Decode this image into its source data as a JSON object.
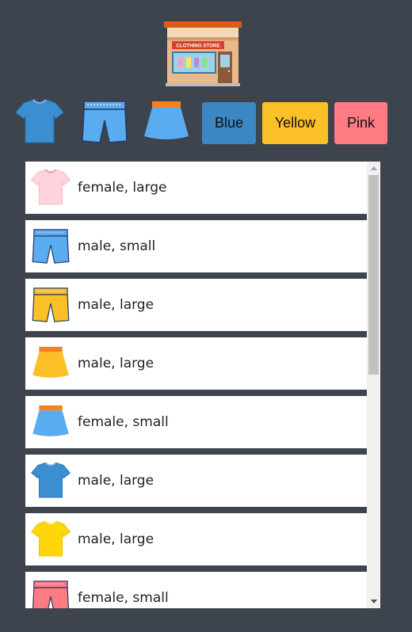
{
  "store": {
    "sign_text": "CLOTHING STORE"
  },
  "filters": {
    "item_types": [
      {
        "icon": "tshirt-icon",
        "color": "#3b8ed0"
      },
      {
        "icon": "shorts-icon",
        "color": "#5aacf0"
      },
      {
        "icon": "skirt-icon",
        "color": "#5aacf0"
      }
    ],
    "colors": [
      {
        "label": "Blue",
        "color": "#3b87c4"
      },
      {
        "label": "Yellow",
        "color": "#fbbf27"
      },
      {
        "label": "Pink",
        "color": "#ff7b83"
      }
    ]
  },
  "items": [
    {
      "icon": "tshirt-icon",
      "color": "#ffd3dc",
      "label": "female, large"
    },
    {
      "icon": "shorts-icon",
      "color": "#5aacf0",
      "label": "male, small"
    },
    {
      "icon": "shorts-icon",
      "color": "#fbbf27",
      "label": "male, large"
    },
    {
      "icon": "skirt-icon",
      "color": "#fbbf27",
      "label": "male, large"
    },
    {
      "icon": "skirt-icon",
      "color": "#5aacf0",
      "label": "female, small"
    },
    {
      "icon": "tshirt-icon",
      "color": "#3b8ed0",
      "label": "male, large"
    },
    {
      "icon": "tshirt-icon",
      "color": "#ffd60a",
      "label": "male, large"
    },
    {
      "icon": "shorts-icon",
      "color": "#ff7b83",
      "label": "female, small"
    }
  ]
}
